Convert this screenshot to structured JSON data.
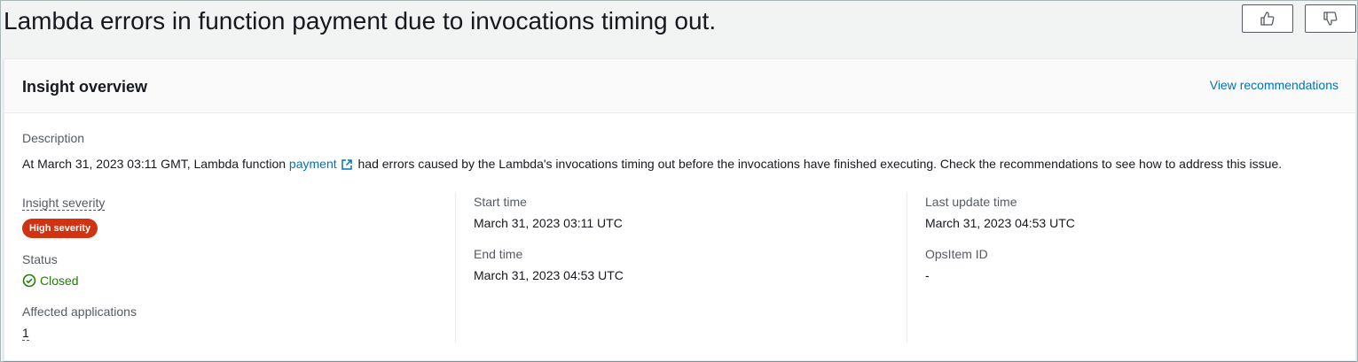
{
  "page_title": "Lambda errors in function payment due to invocations timing out.",
  "feedback": {
    "thumbs_up_icon": "thumbs-up-icon",
    "thumbs_down_icon": "thumbs-down-icon"
  },
  "overview": {
    "title": "Insight overview",
    "view_recommendations": "View recommendations",
    "description_label": "Description",
    "description_prefix": "At March 31, 2023 03:11 GMT, Lambda function ",
    "description_link": "payment",
    "description_suffix": " had errors caused by the Lambda's invocations timing out before the invocations have finished executing. Check the recommendations to see how to address this issue.",
    "severity_label": "Insight severity",
    "severity_value": "High severity",
    "status_label": "Status",
    "status_value": "Closed",
    "affected_label": "Affected applications",
    "affected_value": "1",
    "start_time_label": "Start time",
    "start_time_value": "March 31, 2023 03:11 UTC",
    "end_time_label": "End time",
    "end_time_value": "March 31, 2023 04:53 UTC",
    "last_update_label": "Last update time",
    "last_update_value": "March 31, 2023 04:53 UTC",
    "opsitem_label": "OpsItem ID",
    "opsitem_value": "-"
  },
  "colors": {
    "link": "#0073bb",
    "severity_high": "#d13212",
    "status_ok": "#1d8102"
  }
}
